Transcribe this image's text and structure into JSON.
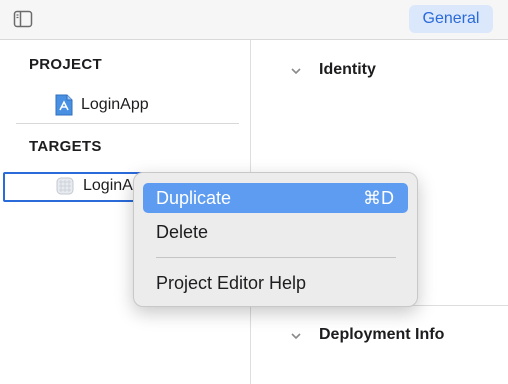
{
  "toolbar": {
    "sidebar_toggle_icon": "sidebar-toggle-icon",
    "general_tab": "General"
  },
  "sidebar": {
    "project_header": "PROJECT",
    "project_item": "LoginApp",
    "targets_header": "TARGETS",
    "target_item": "LoginApp"
  },
  "main": {
    "identity_section": "Identity",
    "deployment_section": "Deployment Info"
  },
  "context_menu": {
    "items": [
      {
        "label": "Duplicate",
        "shortcut": "⌘D",
        "highlighted": true
      },
      {
        "label": "Delete",
        "shortcut": ""
      },
      {
        "label": "Project Editor Help",
        "shortcut": ""
      }
    ]
  },
  "colors": {
    "accent": "#2a6ad9",
    "menu_highlight": "#5e9cf2",
    "tab_bg": "#dbe8fb"
  }
}
